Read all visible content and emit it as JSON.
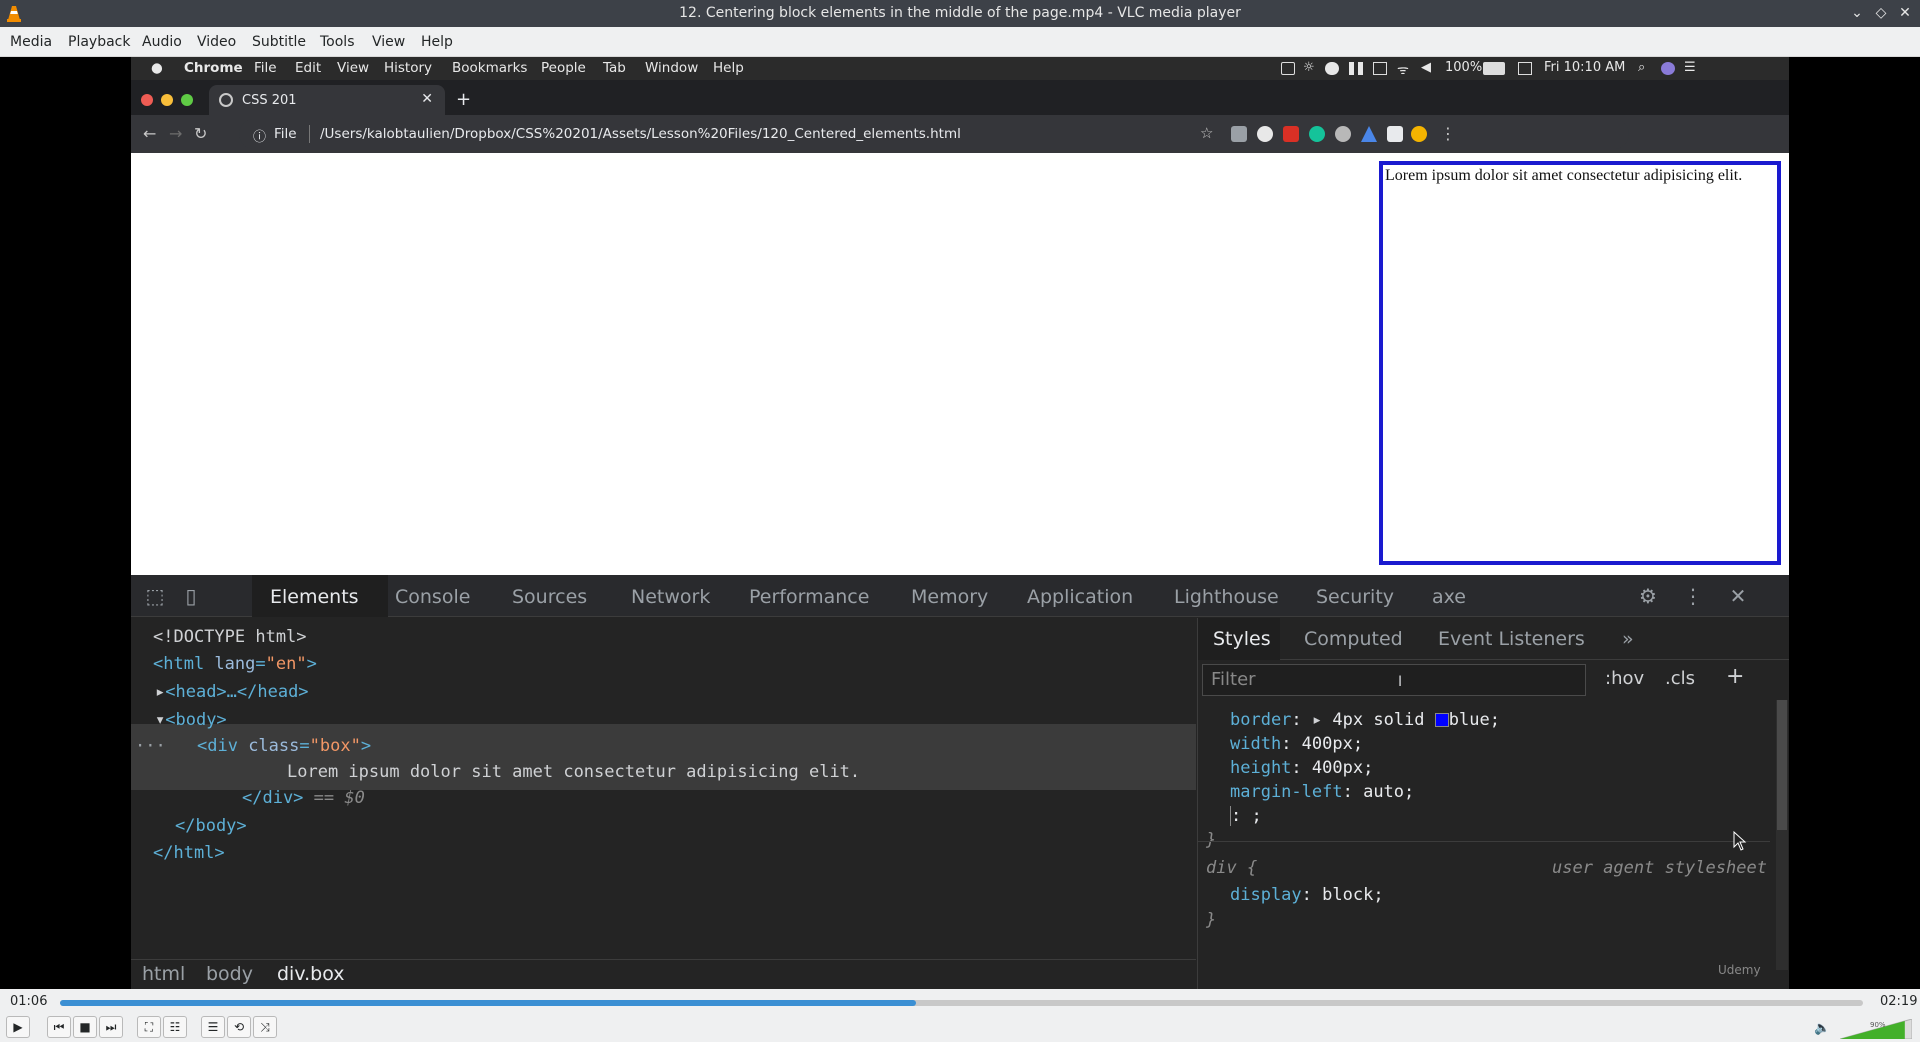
{
  "window": {
    "title": "12. Centering block elements in the middle of the page.mp4 - VLC media player",
    "controls": [
      "minimize-icon",
      "maximize-icon",
      "close-icon"
    ]
  },
  "vlc_menu": [
    "Media",
    "Playback",
    "Audio",
    "Video",
    "Subtitle",
    "Tools",
    "View",
    "Help"
  ],
  "mac_menu": {
    "items": [
      "Chrome",
      "File",
      "Edit",
      "View",
      "History",
      "Bookmarks",
      "People",
      "Tab",
      "Window",
      "Help"
    ],
    "battery": "100%",
    "clock": "Fri 10:10 AM"
  },
  "chrome": {
    "tab_title": "CSS 201",
    "scheme": "File",
    "url": "/Users/kalobtaulien/Dropbox/CSS%20201/Assets/Lesson%20Files/120_Centered_elements.html"
  },
  "page": {
    "box_text": "Lorem ipsum dolor sit amet consectetur adipisicing elit."
  },
  "devtools": {
    "tabs": [
      "Elements",
      "Console",
      "Sources",
      "Network",
      "Performance",
      "Memory",
      "Application",
      "Lighthouse",
      "Security",
      "axe"
    ],
    "active_tab": "Elements",
    "dom": {
      "doctype": "<!DOCTYPE html>",
      "html_open": "<html ",
      "html_attr": "lang",
      "html_val": "\"en\"",
      "head": "<head>…</head>",
      "body_open": "<body>",
      "div_open": "<div ",
      "div_attr": "class",
      "div_val": "\"box\"",
      "div_text": "Lorem ipsum dolor sit amet consectetur adipisicing elit.",
      "div_close": "</div>",
      "div_ref": " == $0",
      "body_close": "</body>",
      "html_close": "</html>"
    },
    "breadcrumbs": [
      "html",
      "body",
      "div.box"
    ],
    "styles_tabs": [
      "Styles",
      "Computed",
      "Event Listeners",
      "»"
    ],
    "filter_placeholder": "Filter",
    "filter_buttons": [
      ":hov",
      ".cls",
      "+"
    ],
    "rules": {
      "border_prop": "border",
      "border_val": "4px solid",
      "border_color_name": "blue",
      "border_color": "#0000ff",
      "width_prop": "width",
      "width_val": "400px;",
      "height_prop": "height",
      "height_val": "400px;",
      "margin_prop": "margin-left",
      "margin_val": "auto;",
      "empty_decl": ": ;",
      "close_brace": "}",
      "ua_selector": "div {",
      "ua_source": "user agent stylesheet",
      "display_prop": "display",
      "display_val": "block;"
    },
    "watermark": "Udemy"
  },
  "player": {
    "elapsed": "01:06",
    "total": "02:19",
    "progress": 0.475,
    "volume": "90%",
    "volume_level": 0.9,
    "accent": "#3b8fd3"
  }
}
